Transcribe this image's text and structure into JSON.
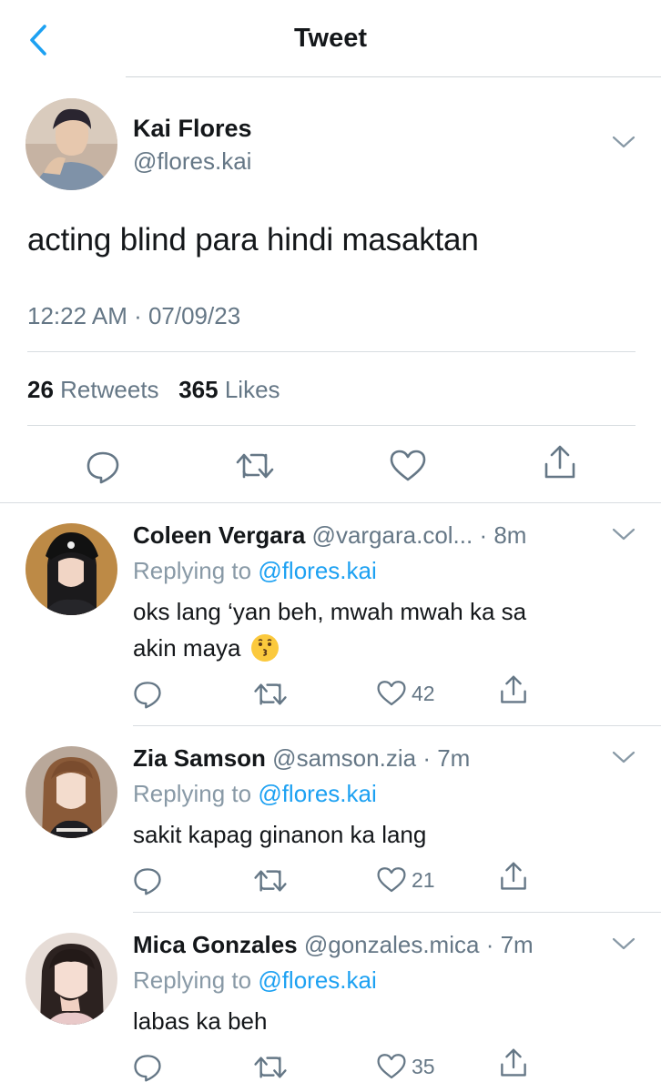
{
  "nav": {
    "title": "Tweet"
  },
  "tweet": {
    "name": "Kai Flores",
    "handle": "@flores.kai",
    "text": "acting blind para hindi masaktan",
    "timestamp": "12:22 AM · 07/09/23",
    "retweets_count": "26",
    "retweets_label": "Retweets",
    "likes_count": "365",
    "likes_label": "Likes"
  },
  "replies": [
    {
      "name": "Coleen Vergara",
      "handle": "@vargara.col...",
      "time": "· 8m",
      "replying_prefix": "Replying to",
      "replying_to": "@flores.kai",
      "text_line1": "oks lang ‘yan beh, mwah mwah ka sa",
      "text_line2": "akin maya",
      "emoji": "kissing-face",
      "likes": "42"
    },
    {
      "name": "Zia Samson",
      "handle": "@samson.zia",
      "time": "· 7m",
      "replying_prefix": "Replying to",
      "replying_to": "@flores.kai",
      "text_line1": "sakit kapag ginanon ka lang",
      "likes": "21"
    },
    {
      "name": "Mica Gonzales",
      "handle": "@gonzales.mica",
      "time": "· 7m",
      "replying_prefix": "Replying to",
      "replying_to": "@flores.kai",
      "text_line1": "labas ka beh",
      "likes": "35"
    }
  ],
  "colors": {
    "accent": "#1da1f2",
    "muted": "#657786",
    "text": "#14171a"
  }
}
